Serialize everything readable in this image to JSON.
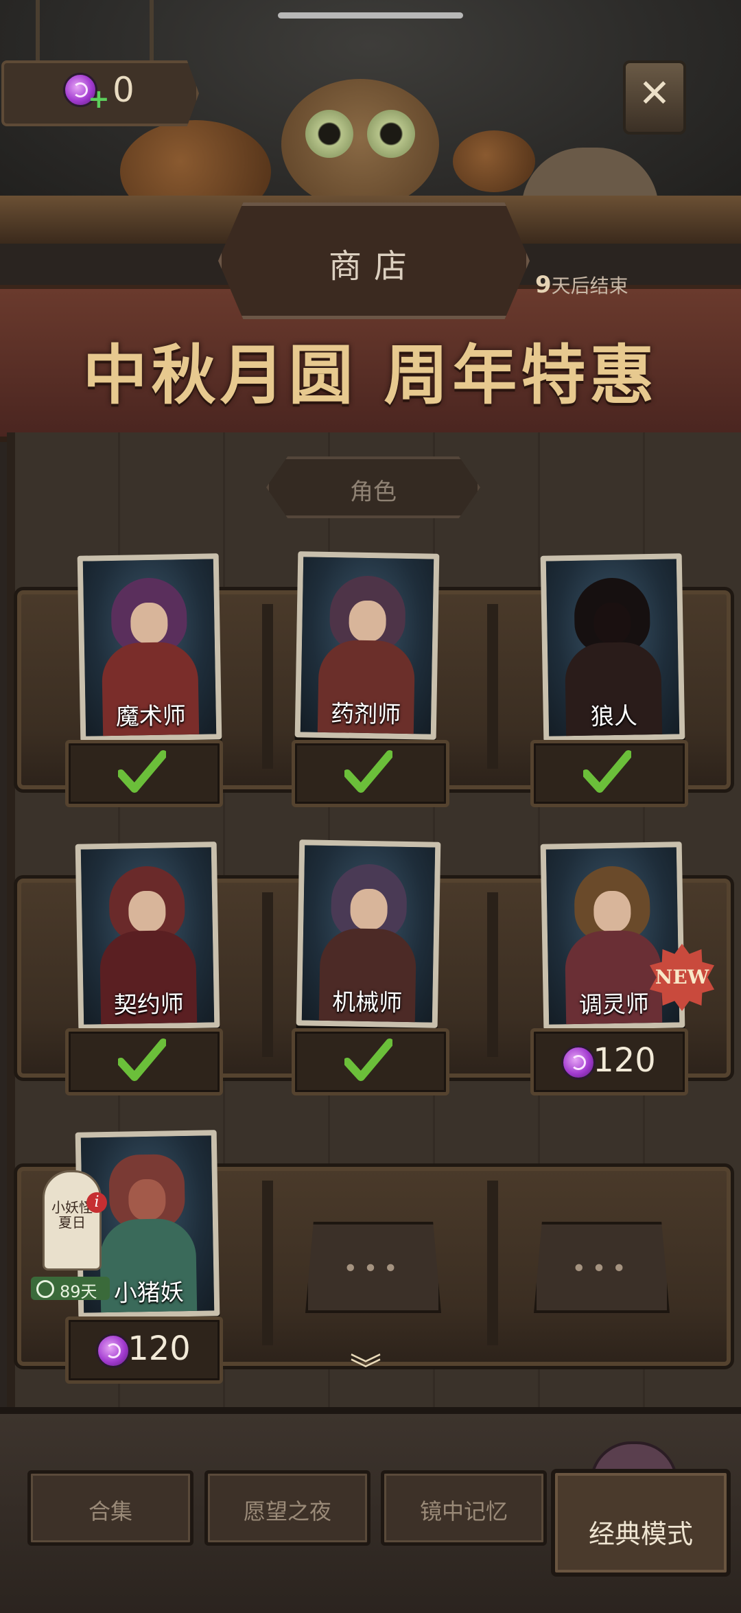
{
  "top": {
    "currency_value": "0",
    "close_icon": "close-icon"
  },
  "header": {
    "shop_title": "商店",
    "ends_days": "9",
    "ends_suffix": "天后结束",
    "banner_title": "中秋月圆 周年特惠"
  },
  "category": "角色",
  "shelves": [
    {
      "cards": [
        {
          "name": "魔术师",
          "status": "owned",
          "hood": "#5a2f5c",
          "body": "#7a2d2a"
        },
        {
          "name": "药剂师",
          "status": "owned",
          "hood": "#4e3448",
          "body": "#6b2f2a"
        },
        {
          "name": "狼人",
          "status": "owned",
          "hood": "#161010",
          "body": "#2a1c1a"
        }
      ]
    },
    {
      "cards": [
        {
          "name": "契约师",
          "status": "owned",
          "hood": "#6a2a2a",
          "body": "#5a1f22"
        },
        {
          "name": "机械师",
          "status": "owned",
          "hood": "#4a3a55",
          "body": "#4c2a26"
        },
        {
          "name": "调灵师",
          "status": "price",
          "price": "120",
          "badge": "NEW",
          "hood": "#6a4a2a",
          "body": "#6a2f35"
        }
      ]
    },
    {
      "cards": [
        {
          "name": "小猪妖",
          "status": "price",
          "price": "120",
          "hood": "#7a3a34",
          "body": "#3a6a5a"
        }
      ],
      "empty_slots": [
        "•••",
        "•••"
      ]
    }
  ],
  "limited": {
    "tomb_text": "小妖怪夏日",
    "days_left": "89天",
    "info": "i"
  },
  "bottom_tabs": [
    "合集",
    "愿望之夜",
    "镜中记忆"
  ],
  "classic_mode": "经典模式",
  "colors": {
    "banner": "#5a2e25",
    "check_green": "#6bbf3a",
    "candy_purple": "#a23bd0"
  }
}
